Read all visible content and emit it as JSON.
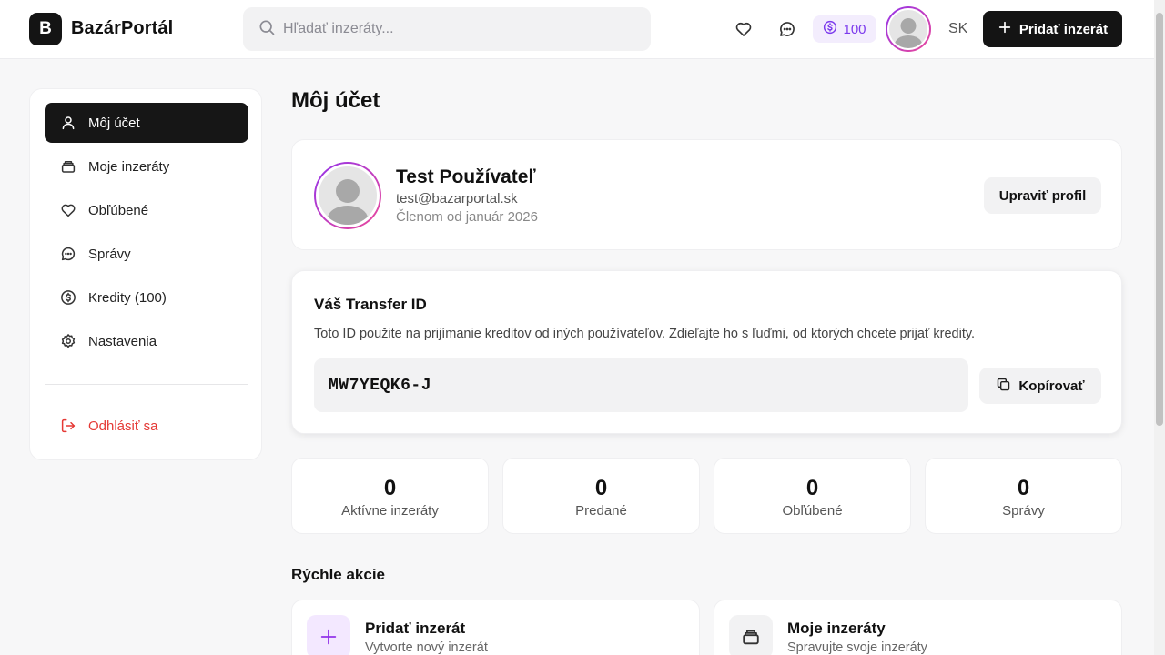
{
  "header": {
    "logo_letter": "B",
    "logo_text": "BazárPortál",
    "search_placeholder": "Hľadať inzeráty...",
    "credits": "100",
    "language": "SK",
    "add_listing_label": "Pridať inzerát"
  },
  "sidebar": {
    "items": [
      {
        "label": "Môj účet",
        "icon": "user-icon",
        "active": true
      },
      {
        "label": "Moje inzeráty",
        "icon": "box-icon"
      },
      {
        "label": "Obľúbené",
        "icon": "heart-icon"
      },
      {
        "label": "Správy",
        "icon": "chat-icon"
      },
      {
        "label": "Kredity (100)",
        "icon": "dollar-icon"
      },
      {
        "label": "Nastavenia",
        "icon": "gear-icon"
      }
    ],
    "logout_label": "Odhlásiť sa"
  },
  "main": {
    "title": "Môj účet",
    "profile": {
      "name": "Test Používateľ",
      "email": "test@bazarportal.sk",
      "member_since": "Členom od január 2026",
      "edit_label": "Upraviť profil"
    },
    "transfer": {
      "title": "Váš Transfer ID",
      "description": "Toto ID použite na prijímanie kreditov od iných používateľov. Zdieľajte ho s ľuďmi, od ktorých chcete prijať kredity.",
      "id": "MW7YEQK6-J",
      "copy_label": "Kopírovať"
    },
    "stats": [
      {
        "value": "0",
        "label": "Aktívne inzeráty"
      },
      {
        "value": "0",
        "label": "Predané"
      },
      {
        "value": "0",
        "label": "Obľúbené"
      },
      {
        "value": "0",
        "label": "Správy"
      }
    ],
    "quick_actions_title": "Rýchle akcie",
    "quick_actions": [
      {
        "name": "Pridať inzerát",
        "sub": "Vytvorte nový inzerát",
        "icon": "plus-icon"
      },
      {
        "name": "Moje inzeráty",
        "sub": "Spravujte svoje inzeráty",
        "icon": "box-icon"
      }
    ]
  },
  "colors": {
    "accent": "#7c3aed",
    "primary": "#141414",
    "danger": "#e53935"
  }
}
